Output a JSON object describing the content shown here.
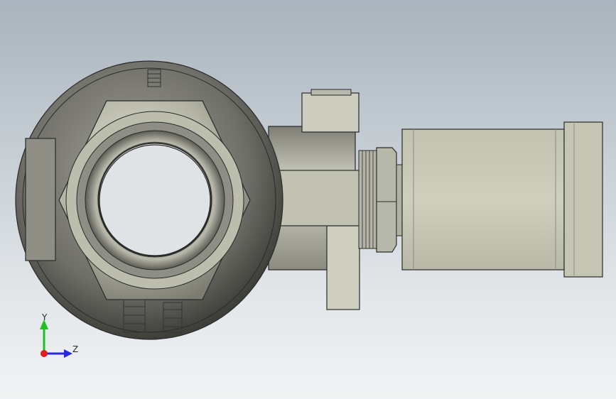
{
  "app": "CAD viewport",
  "view": {
    "background_top": "#a9b3bd",
    "background_bottom": "#f1f2f3",
    "model_color": "#c8c8b6",
    "edge_color": "#2a2a2a"
  },
  "triad": {
    "y_label": "Y",
    "z_label": "Z",
    "y_color": "#1ec21e",
    "z_color": "#2727e0",
    "x_color": "#e01e1e"
  }
}
